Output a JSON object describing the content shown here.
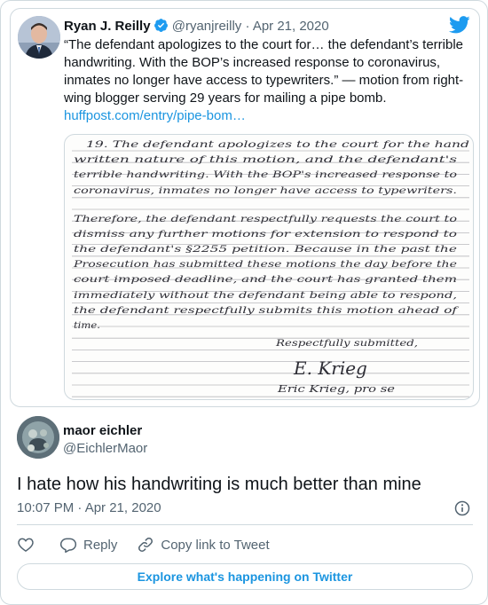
{
  "quoted_tweet": {
    "author_name": "Ryan J. Reilly",
    "author_handle": "@ryanjreilly",
    "separator": "·",
    "date": "Apr 21, 2020",
    "text": "“The defendant apologizes to the court for… the defendant’s terrible handwriting. With the BOP’s increased response to coronavirus, inmates no longer have access to typewriters.” — motion from right-wing blogger serving 29 years for mailing a pipe bomb.",
    "link_text": "huffpost.com/entry/pipe-bom…",
    "media": {
      "lines": [
        "19.  The defendant apologizes to the court for the hand",
        "written nature of this motion, and the defendant's",
        "terrible handwriting.  With the BOP's increased response to",
        "coronavirus, inmates no longer have access to typewriters.",
        "Therefore, the defendant respectfully requests the court to",
        "dismiss any further motions for extension to respond to",
        "the defendant's §2255 petition.  Because in the past the",
        "Prosecution has submitted these motions the day before the",
        "court imposed deadline, and the court has granted them",
        "immediately without the defendant being able to respond,",
        "the defendant respectfully submits this motion ahead of",
        "time."
      ],
      "closing": "Respectfully submitted,",
      "signature": "E. Krieg",
      "signer": "Eric Krieg, pro se"
    }
  },
  "tweet": {
    "author_name": "maor eichler",
    "author_handle": "@EichlerMaor",
    "text": "I hate how his handwriting is much better than mine",
    "timestamp": "10:07 PM · Apr 21, 2020"
  },
  "actions": {
    "reply_label": "Reply",
    "copy_link_label": "Copy link to Tweet",
    "explore_label": "Explore what's happening on Twitter"
  },
  "icons": {
    "verified": "verified-badge-icon",
    "brand": "twitter-bird-icon",
    "like": "heart-icon",
    "reply": "speech-bubble-icon",
    "copy_link": "link-icon",
    "info": "info-icon"
  },
  "colors": {
    "link": "#1b95e0",
    "secondary_text": "#536471",
    "border": "#cfd9de",
    "verified_blue": "#1d9bf0"
  }
}
